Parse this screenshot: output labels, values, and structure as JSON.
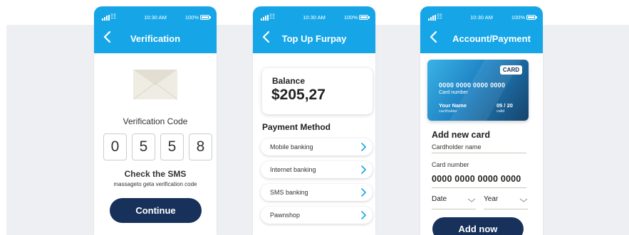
{
  "status": {
    "time": "10:30 AM",
    "battery": "100%"
  },
  "verification": {
    "title": "Verification",
    "code_label": "Verification Code",
    "digits": [
      "0",
      "5",
      "5",
      "8"
    ],
    "sms_title": "Check the SMS",
    "sms_subtitle": "massageto geta verification code",
    "continue_label": "Continue"
  },
  "topup": {
    "title": "Top Up Furpay",
    "balance_label": "Balance",
    "balance_value": "$205,27",
    "payment_method_title": "Payment Method",
    "methods": [
      "Mobile banking",
      "Internet banking",
      "SMS banking",
      "Pawnshop"
    ]
  },
  "account": {
    "title": "Account/Payment",
    "card": {
      "badge": "CARD",
      "number": "0000 0000 0000 0000",
      "number_label": "Card number",
      "holder": "Your Name",
      "holder_label": "cardholder",
      "valid": "05 / 20",
      "valid_label": "valid"
    },
    "add_card_title": "Add new card",
    "cardholder_label": "Cardholder name",
    "card_number_label": "Card number",
    "card_number_value": "0000 0000 0000 0000",
    "date_label": "Date",
    "year_label": "Year",
    "add_now_label": "Add now"
  },
  "colors": {
    "header": "#16a6e8",
    "button": "#17315a",
    "background": "#eeeff2",
    "accent_chevron": "#16a6e8"
  },
  "icons": [
    "signal-icon",
    "wifi-icon",
    "battery-icon",
    "back-arrow-icon",
    "envelope-icon",
    "chevron-right-icon",
    "chevron-down-icon"
  ]
}
